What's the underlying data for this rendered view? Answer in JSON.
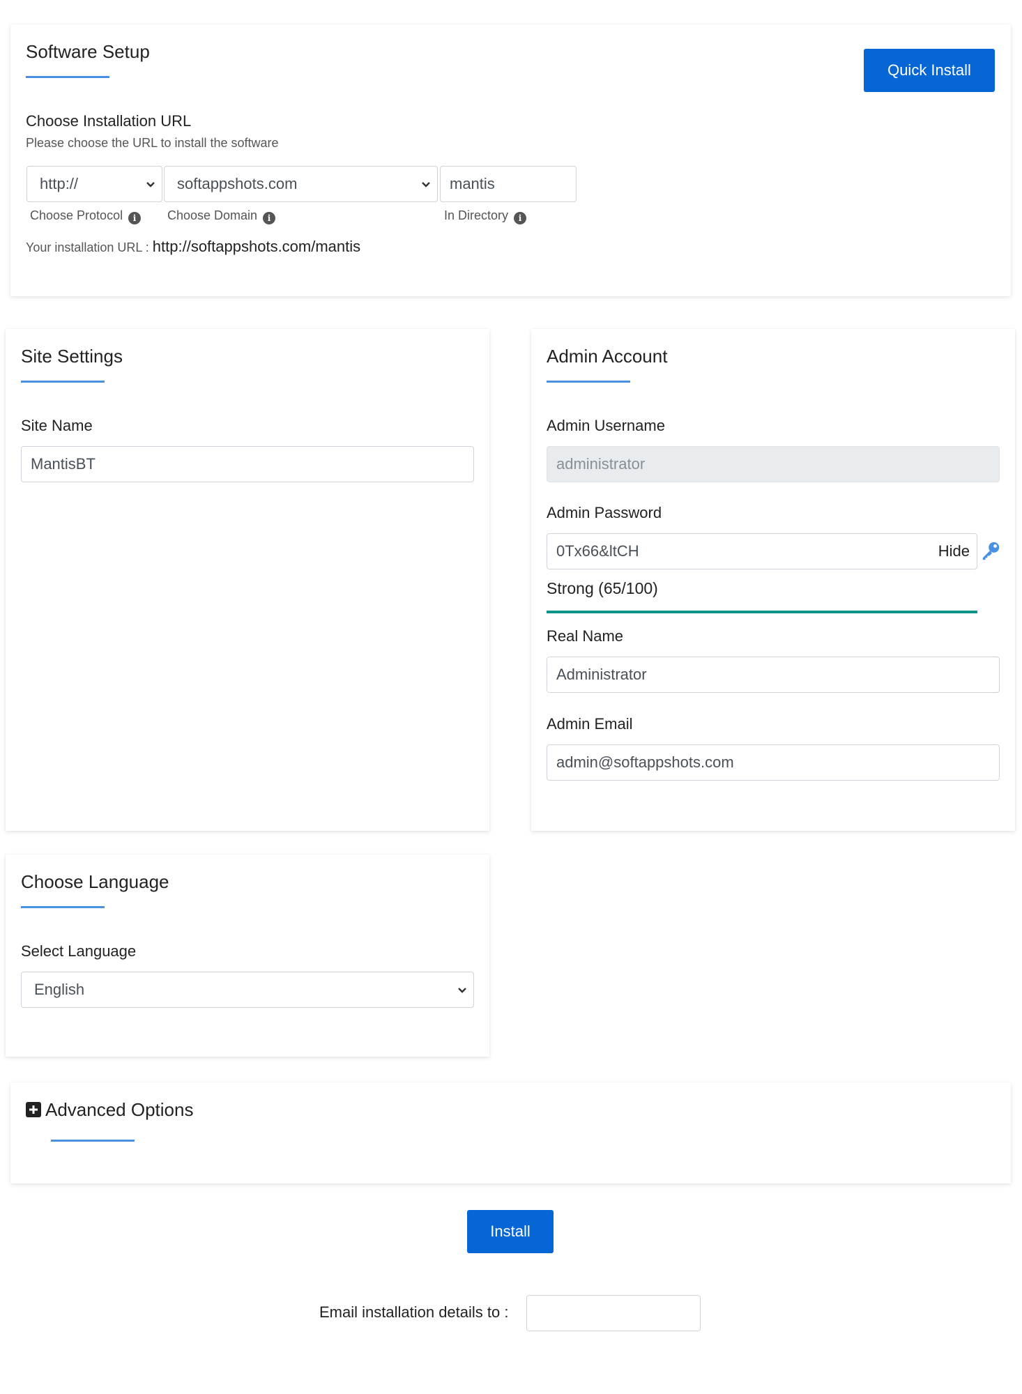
{
  "software_setup": {
    "title": "Software Setup",
    "quick_install_label": "Quick Install",
    "choose_url_label": "Choose Installation URL",
    "choose_url_help": "Please choose the URL to install the software",
    "protocol_value": "http://",
    "domain_value": "softappshots.com",
    "directory_value": "mantis",
    "protocol_caption": "Choose Protocol",
    "domain_caption": "Choose Domain",
    "directory_caption": "In Directory",
    "install_url_prefix": "Your installation URL :",
    "install_url_value": "http://softappshots.com/mantis"
  },
  "site_settings": {
    "title": "Site Settings",
    "site_name_label": "Site Name",
    "site_name_value": "MantisBT"
  },
  "admin_account": {
    "title": "Admin Account",
    "username_label": "Admin Username",
    "username_value": "administrator",
    "password_label": "Admin Password",
    "password_value": "0Tx66&ltCH",
    "hide_label": "Hide",
    "strength_text": "Strong (65/100)",
    "strength_percent": 65,
    "strength_color": "#0f9488",
    "real_name_label": "Real Name",
    "real_name_value": "Administrator",
    "email_label": "Admin Email",
    "email_value": "admin@softappshots.com"
  },
  "language": {
    "title": "Choose Language",
    "select_label": "Select Language",
    "selected_value": "English"
  },
  "advanced": {
    "title": "Advanced Options"
  },
  "footer": {
    "install_label": "Install",
    "email_details_label": "Email installation details to :",
    "email_details_value": ""
  },
  "colors": {
    "accent": "#4a90e2",
    "button": "#0766d6",
    "key_icon": "#4a90e2"
  },
  "icons": {
    "info": "info-circle-icon",
    "key": "key-icon",
    "plus": "plus-square-icon",
    "chevron": "chevron-down-icon"
  }
}
